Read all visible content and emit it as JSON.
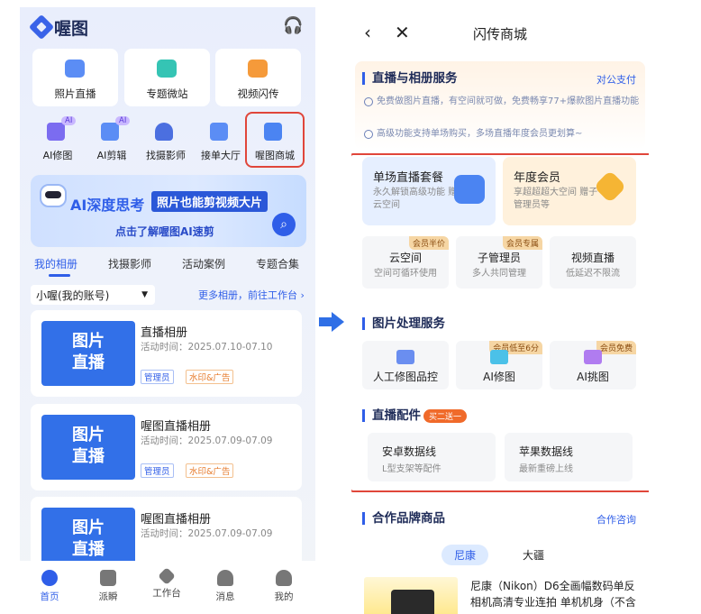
{
  "left": {
    "app_name": "喔图",
    "top_cards": [
      {
        "label": "照片直播",
        "icon": "camera-icon",
        "color": "#5b8df5"
      },
      {
        "label": "专题微站",
        "icon": "site-icon",
        "color": "#35c4b4"
      },
      {
        "label": "视频闪传",
        "icon": "video-icon",
        "color": "#f59a3a"
      }
    ],
    "tools": [
      {
        "label": "AI修图",
        "badge": "AI",
        "icon": "ai-retouch-icon"
      },
      {
        "label": "AI剪辑",
        "badge": "AI",
        "icon": "ai-edit-icon"
      },
      {
        "label": "找摄影师",
        "badge": "",
        "icon": "photographer-icon"
      },
      {
        "label": "接单大厅",
        "badge": "",
        "icon": "order-hall-icon"
      },
      {
        "label": "喔图商城",
        "badge": "",
        "icon": "store-icon"
      }
    ],
    "banner": {
      "title": "AI深度思考",
      "highlight": "照片也能剪视频大片",
      "cta": "点击了解喔图AI速剪"
    },
    "tabs": [
      "我的相册",
      "找摄影师",
      "活动案例",
      "专题合集"
    ],
    "account": "小喔(我的账号)",
    "more_link": "更多相册，前往工作台 ›",
    "albums": [
      {
        "thumb_line1": "图片",
        "thumb_line2": "直播",
        "name": "直播相册",
        "time": "活动时间：2025.07.10-07.10",
        "tag1": "管理员",
        "tag2": "水印&广告"
      },
      {
        "thumb_line1": "图片",
        "thumb_line2": "直播",
        "name": "喔图直播相册",
        "time": "活动时间：2025.07.09-07.09",
        "tag1": "管理员",
        "tag2": "水印&广告"
      },
      {
        "thumb_line1": "图片",
        "thumb_line2": "直播",
        "name": "喔图直播相册",
        "time": "活动时间：2025.07.09-07.09",
        "tag1": "",
        "tag2": ""
      }
    ],
    "nav": [
      "首页",
      "派瞬",
      "工作台",
      "消息",
      "我的"
    ]
  },
  "right": {
    "title": "闪传商城",
    "section1": {
      "title": "直播与相册服务",
      "link": "对公支付",
      "feature1": "免费做图片直播，有空间就可做，免费畅享77+爆款图片直播功能",
      "feature2": "高级功能支持单场购买，多场直播年度会员更划算~"
    },
    "plans": [
      {
        "name": "单场直播套餐",
        "desc": "永久解锁高级功能 赠云空间",
        "color": "#e6efff",
        "icon_color": "#4b84f2"
      },
      {
        "name": "年度会员",
        "desc": "享超超超大空间 赠子管理员等",
        "color": "#fff1dc",
        "icon_color": "#f5b534"
      }
    ],
    "small_items": [
      {
        "name": "云空间",
        "desc": "空间可循环使用",
        "badge": "会员半价"
      },
      {
        "name": "子管理员",
        "desc": "多人共同管理",
        "badge": "会员专属"
      },
      {
        "name": "视频直播",
        "desc": "低延迟不限流",
        "badge": ""
      }
    ],
    "section2": {
      "title": "图片处理服务"
    },
    "process": [
      {
        "name": "人工修图品控",
        "badge": "",
        "icon": "retouch-icon"
      },
      {
        "name": "AI修图",
        "badge": "会员低至6分",
        "icon": "ai-retouch-icon"
      },
      {
        "name": "AI挑图",
        "badge": "会员免费",
        "icon": "ai-pick-icon"
      }
    ],
    "section3": {
      "title": "直播配件",
      "promo": "买二送一"
    },
    "accessories": [
      {
        "name": "安卓数据线",
        "desc": "L型支架等配件"
      },
      {
        "name": "苹果数据线",
        "desc": "最新重磅上线"
      }
    ],
    "section4": {
      "title": "合作品牌商品",
      "link": "合作咨询"
    },
    "brand_tabs": [
      "尼康",
      "大疆"
    ],
    "product": {
      "title": "尼康（Nikon）D6全画幅数码单反相机高清专业连拍 单机机身（不含"
    }
  },
  "colors": {
    "accent": "#2f5ee8",
    "highlight_red": "#e0463a",
    "arrow": "#2f6fe6"
  }
}
